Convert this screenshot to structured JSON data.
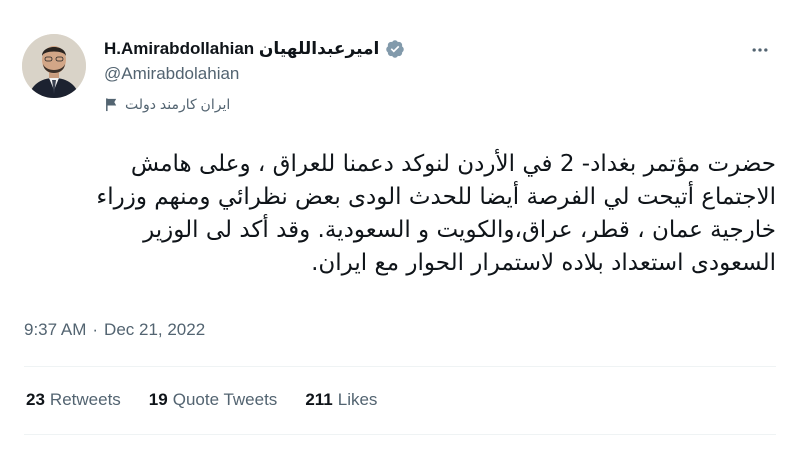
{
  "tweet": {
    "author": {
      "display_name": "H.Amirabdollahian امیرعبداللهیان",
      "handle": "@Amirabdolahian",
      "label": "ایران کارمند دولت",
      "verified_icon": "verified-badge-icon",
      "label_icon": "flag-icon"
    },
    "text_lines": [
      "حضرت مؤتمر بغداد- 2 في الأردن لنوكد دعمنا للعراق ، وعلى هامش",
      "الاجتماع أتيحت لي الفرصة أيضا للحدث الودى بعض نظرائي ومنهم وزراء",
      "خارجية عمان ، قطر، عراق،والكويت و السعودية. وقد أكد لى الوزير",
      "السعودى استعداد بلاده لاستمرار الحوار مع ایران."
    ],
    "time": "9:37 AM",
    "separator": "·",
    "date": "Dec 21, 2022",
    "stats": {
      "retweets_count": "23",
      "retweets_label": "Retweets",
      "quotes_count": "19",
      "quotes_label": "Quote Tweets",
      "likes_count": "211",
      "likes_label": "Likes"
    }
  },
  "colors": {
    "text_primary": "#0f1419",
    "text_secondary": "#536471",
    "verified_badge": "#829aab",
    "divider": "#eff3f4"
  }
}
